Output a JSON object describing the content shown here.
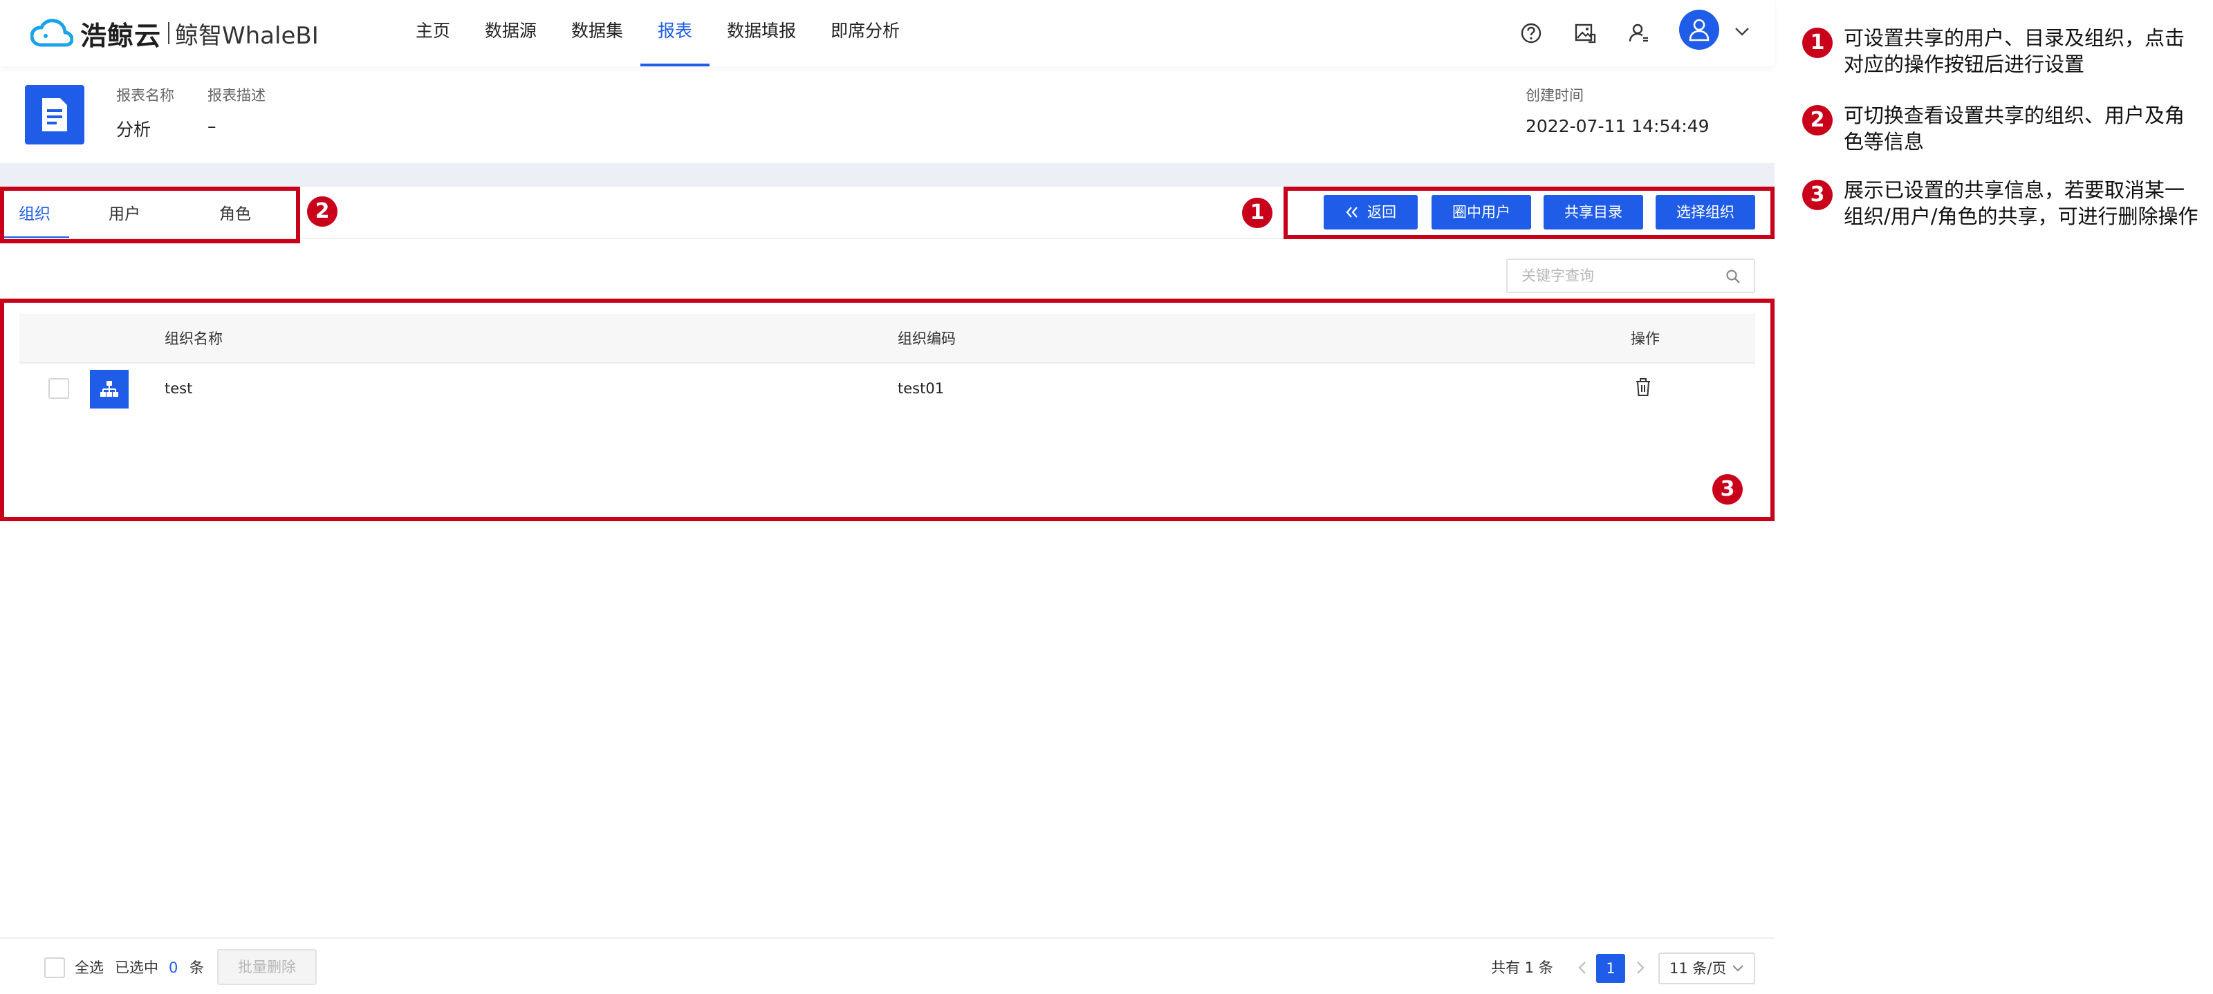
{
  "logo": {
    "brand": "浩鲸云",
    "product": "鲸智WhaleBI"
  },
  "nav": {
    "items": [
      {
        "label": "主页"
      },
      {
        "label": "数据源"
      },
      {
        "label": "数据集"
      },
      {
        "label": "报表"
      },
      {
        "label": "数据填报"
      },
      {
        "label": "即席分析"
      }
    ],
    "active": "报表"
  },
  "report": {
    "name_label": "报表名称",
    "name_value": "分析",
    "desc_label": "报表描述",
    "desc_value": "–",
    "created_label": "创建时间",
    "created_value": "2022-07-11 14:54:49"
  },
  "tabs": [
    {
      "label": "组织"
    },
    {
      "label": "用户"
    },
    {
      "label": "角色"
    }
  ],
  "actions": {
    "back": "返回",
    "circle_users": "圈中用户",
    "share_dir": "共享目录",
    "select_org": "选择组织"
  },
  "search": {
    "placeholder": "关键字查询"
  },
  "table": {
    "headers": {
      "name": "组织名称",
      "code": "组织编码",
      "op": "操作"
    },
    "rows": [
      {
        "name": "test",
        "code": "test01"
      }
    ]
  },
  "footer": {
    "select_all": "全选",
    "selected_prefix": "已选中",
    "selected_count": "0",
    "selected_suffix": "条",
    "batch_delete": "批量删除",
    "total": "共有 1 条",
    "current_page": "1",
    "page_size": "11 条/页"
  },
  "annotations": {
    "badges": [
      "1",
      "2",
      "3"
    ],
    "notes": [
      {
        "num": "1",
        "text": "可设置共享的用户、目录及组织，点击对应的操作按钮后进行设置"
      },
      {
        "num": "2",
        "text": "可切换查看设置共享的组织、用户及角色等信息"
      },
      {
        "num": "3",
        "text": "展示已设置的共享信息，若要取消某一组织/用户/角色的共享，可进行删除操作"
      }
    ]
  },
  "colors": {
    "primary": "#1f5de8",
    "annotation_red": "#c8001a"
  }
}
